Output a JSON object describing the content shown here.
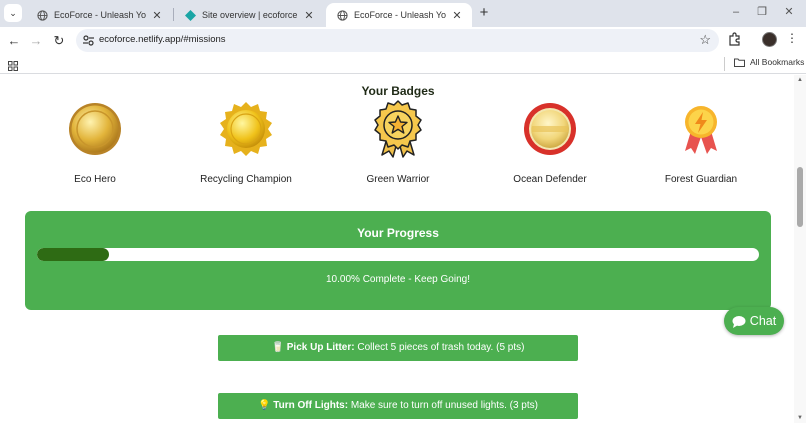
{
  "browser": {
    "tabs": [
      {
        "title": "EcoForce - Unleash Your Inner",
        "favicon": "globe-icon",
        "active": false
      },
      {
        "title": "Site overview | ecoforce | Netlify",
        "favicon": "netlify-icon",
        "active": false
      },
      {
        "title": "EcoForce - Unleash Your Inner",
        "favicon": "globe-icon",
        "active": true
      }
    ],
    "close_glyph": "✕",
    "new_tab_glyph": "+",
    "url": "ecoforce.netlify.app/#missions",
    "bookmarks_folder": "All Bookmarks"
  },
  "badges": {
    "title": "Your Badges",
    "items": [
      {
        "label": "Eco Hero",
        "icon": "gold-coin-medal-icon"
      },
      {
        "label": "Recycling Champion",
        "icon": "gold-seal-medal-icon"
      },
      {
        "label": "Green Warrior",
        "icon": "star-rosette-icon"
      },
      {
        "label": "Ocean Defender",
        "icon": "red-ring-medal-icon"
      },
      {
        "label": "Forest Guardian",
        "icon": "lightning-ribbon-medal-icon"
      }
    ]
  },
  "progress": {
    "title": "Your Progress",
    "percent": 10,
    "text": "10.00% Complete - Keep Going!"
  },
  "missions": [
    {
      "emoji": "🥛",
      "name": "Pick Up Litter:",
      "desc": " Collect 5 pieces of trash today. (5 pts)"
    },
    {
      "emoji": "💡",
      "name": "Turn Off Lights:",
      "desc": " Make sure to turn off unused lights. (3 pts)"
    }
  ],
  "chat": {
    "label": "Chat",
    "icon": "speech-bubble-icon"
  },
  "colors": {
    "accent_green": "#4caf50",
    "progress_fill": "#2e6b14"
  }
}
